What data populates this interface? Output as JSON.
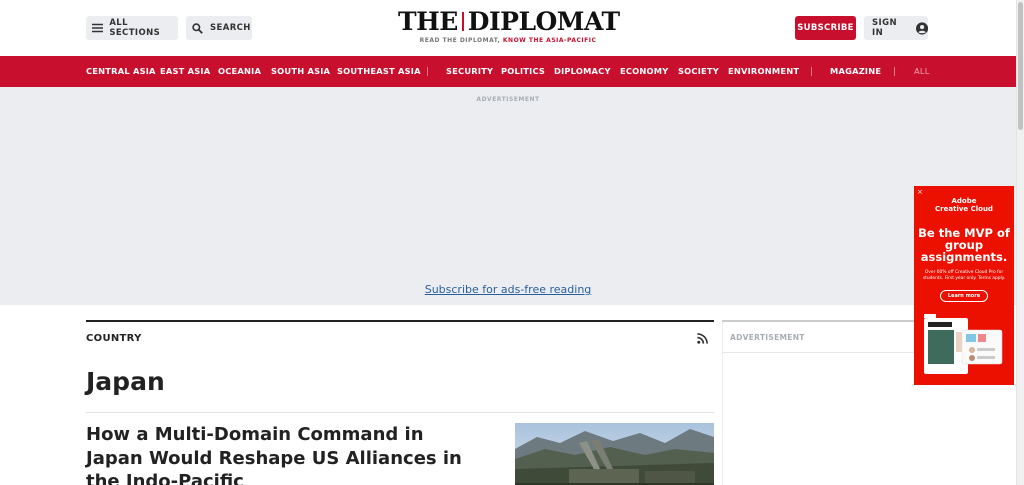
{
  "header": {
    "all_sections": "ALL SECTIONS",
    "search": "SEARCH",
    "logo_main_left": "THE",
    "logo_main_right": "DIPLOMAT",
    "tagline_left": "READ THE DIPLOMAT,",
    "tagline_right": "KNOW THE ASIA-PACIFIC",
    "subscribe": "SUBSCRIBE",
    "sign_in": "SIGN IN",
    "accent_color": "#c8102e"
  },
  "nav": {
    "regions": [
      "CENTRAL ASIA",
      "EAST ASIA",
      "OCEANIA",
      "SOUTH ASIA",
      "SOUTHEAST ASIA"
    ],
    "topics": [
      "SECURITY",
      "POLITICS",
      "DIPLOMACY",
      "ECONOMY",
      "SOCIETY",
      "ENVIRONMENT"
    ],
    "magazine": "MAGAZINE",
    "all": "ALL"
  },
  "ad_band": {
    "label": "ADVERTISEMENT",
    "subscribe_link": "Subscribe for ads-free reading"
  },
  "main": {
    "section_label": "COUNTRY",
    "title": "Japan",
    "articles": [
      {
        "title": "How a Multi-Domain Command in Japan Would Reshape US Alliances in the Indo-Pacific"
      }
    ]
  },
  "sidebar": {
    "ad_label": "ADVERTISEMENT"
  },
  "floating_ad": {
    "brand_line1": "Adobe",
    "brand_line2": "Creative Cloud",
    "headline": "Be the MVP of group assignments.",
    "body": "Over 60% off Creative Cloud Pro for students. First year only. Terms apply.",
    "button": "Learn more",
    "close": "×"
  }
}
